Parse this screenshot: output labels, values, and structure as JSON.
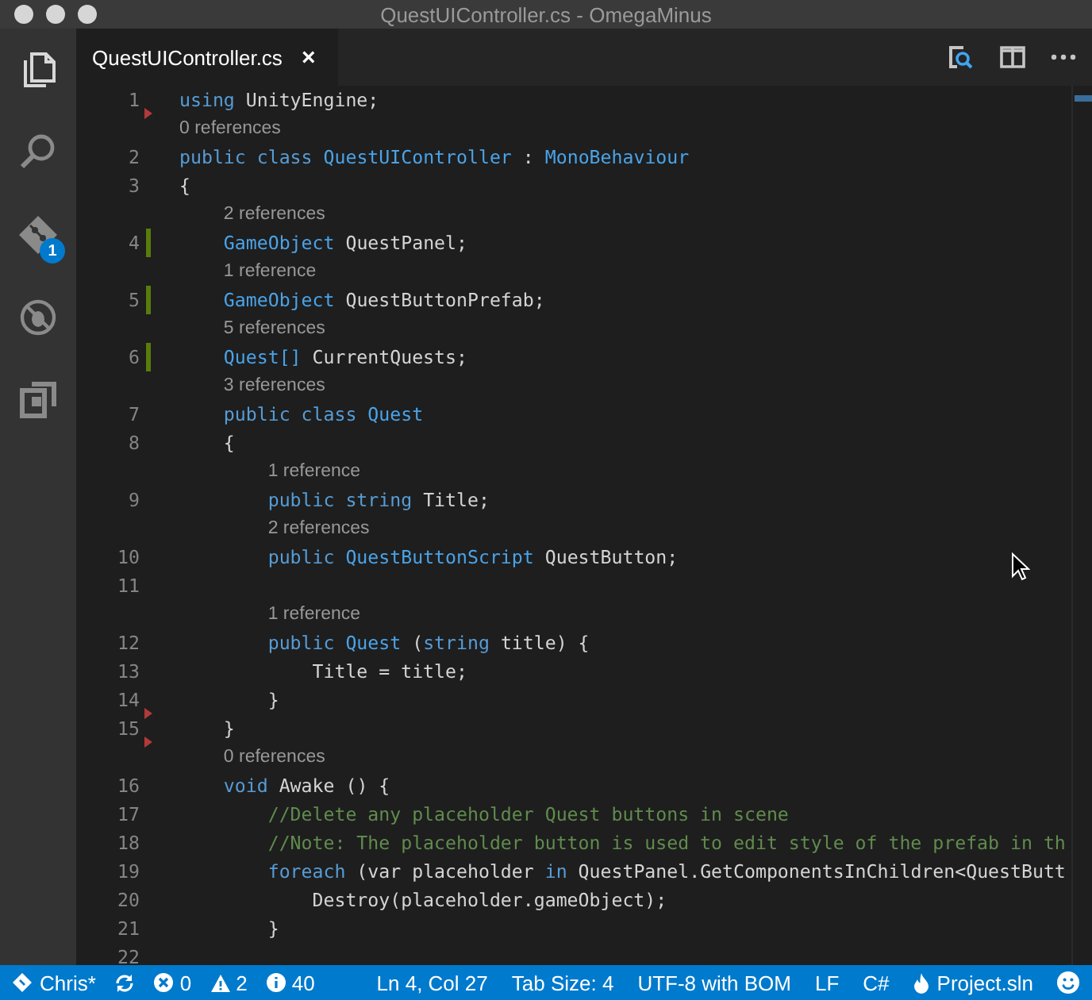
{
  "window": {
    "title": "QuestUIController.cs - OmegaMinus"
  },
  "activity_bar": [
    {
      "kind": "files",
      "selected": true
    },
    {
      "kind": "search",
      "selected": false
    },
    {
      "kind": "git",
      "selected": false,
      "badge": "1"
    },
    {
      "kind": "debug",
      "selected": false
    },
    {
      "kind": "extensions",
      "selected": false
    }
  ],
  "tabs": [
    {
      "label": "QuestUIController.cs",
      "close": "×",
      "selected": true
    }
  ],
  "editor_actions": [
    {
      "kind": "preview"
    },
    {
      "kind": "split"
    },
    {
      "kind": "more"
    }
  ],
  "lines": [
    {
      "number": "1",
      "added": false,
      "deleted": true,
      "tokens": [
        {
          "kind": "keyword",
          "text": "using"
        },
        {
          "kind": "plain",
          "text": " UnityEngine;"
        }
      ]
    },
    {
      "number": "2",
      "added": false,
      "deleted": false,
      "lens": "0 references",
      "tokens": [
        {
          "kind": "keyword",
          "text": "public class "
        },
        {
          "kind": "type",
          "text": "QuestUIController"
        },
        {
          "kind": "plain",
          "text": " : "
        },
        {
          "kind": "type",
          "text": "MonoBehaviour"
        }
      ]
    },
    {
      "number": "3",
      "added": false,
      "deleted": false,
      "tokens": [
        {
          "kind": "plain",
          "text": "{"
        }
      ]
    },
    {
      "number": "4",
      "added": true,
      "deleted": false,
      "lens": "2 references",
      "tokens": [
        {
          "kind": "type",
          "text": "    GameObject"
        },
        {
          "kind": "plain",
          "text": " QuestPanel;"
        }
      ]
    },
    {
      "number": "5",
      "added": true,
      "deleted": false,
      "lens": "1 reference",
      "tokens": [
        {
          "kind": "type",
          "text": "    GameObject"
        },
        {
          "kind": "plain",
          "text": " QuestButtonPrefab;"
        }
      ]
    },
    {
      "number": "6",
      "added": true,
      "deleted": false,
      "lens": "5 references",
      "tokens": [
        {
          "kind": "type",
          "text": "    Quest[]"
        },
        {
          "kind": "plain",
          "text": " CurrentQuests;"
        }
      ]
    },
    {
      "number": "7",
      "added": false,
      "deleted": false,
      "lens": "3 references",
      "tokens": [
        {
          "kind": "keyword",
          "text": "    public class "
        },
        {
          "kind": "type",
          "text": "Quest"
        }
      ]
    },
    {
      "number": "8",
      "added": false,
      "deleted": false,
      "tokens": [
        {
          "kind": "plain",
          "text": "    {"
        }
      ]
    },
    {
      "number": "9",
      "added": false,
      "deleted": false,
      "lens": "1 reference",
      "tokens": [
        {
          "kind": "keyword",
          "text": "        public string "
        },
        {
          "kind": "plain",
          "text": "Title;"
        }
      ]
    },
    {
      "number": "10",
      "added": false,
      "deleted": false,
      "lens": "2 references",
      "tokens": [
        {
          "kind": "keyword",
          "text": "        public "
        },
        {
          "kind": "type",
          "text": "QuestButtonScript"
        },
        {
          "kind": "plain",
          "text": " QuestButton;"
        }
      ]
    },
    {
      "number": "11",
      "added": false,
      "deleted": false
    },
    {
      "number": "12",
      "added": false,
      "deleted": false,
      "lens": "1 reference",
      "tokens": [
        {
          "kind": "keyword",
          "text": "        public "
        },
        {
          "kind": "type",
          "text": "Quest"
        },
        {
          "kind": "plain",
          "text": " ("
        },
        {
          "kind": "keyword",
          "text": "string"
        },
        {
          "kind": "plain",
          "text": " title) {"
        }
      ]
    },
    {
      "number": "13",
      "added": false,
      "deleted": false,
      "tokens": [
        {
          "kind": "plain",
          "text": "            Title = title;"
        }
      ]
    },
    {
      "number": "14",
      "added": false,
      "deleted": true,
      "tokens": [
        {
          "kind": "plain",
          "text": "        }"
        }
      ]
    },
    {
      "number": "15",
      "added": false,
      "deleted": true,
      "tokens": [
        {
          "kind": "plain",
          "text": "    }"
        }
      ]
    },
    {
      "number": "16",
      "added": false,
      "deleted": false,
      "lens": "0 references",
      "tokens": [
        {
          "kind": "keyword",
          "text": "    void "
        },
        {
          "kind": "plain",
          "text": "Awake () {"
        }
      ]
    },
    {
      "number": "17",
      "added": false,
      "deleted": false,
      "tokens": [
        {
          "kind": "comment",
          "text": "        //Delete any placeholder Quest buttons in scene"
        }
      ]
    },
    {
      "number": "18",
      "added": false,
      "deleted": false,
      "tokens": [
        {
          "kind": "comment",
          "text": "        //Note: The placeholder button is used to edit style of the prefab in th"
        }
      ]
    },
    {
      "number": "19",
      "added": false,
      "deleted": false,
      "tokens": [
        {
          "kind": "keyword",
          "text": "        foreach"
        },
        {
          "kind": "plain",
          "text": " (var placeholder "
        },
        {
          "kind": "keyword",
          "text": "in"
        },
        {
          "kind": "plain",
          "text": " QuestPanel.GetComponentsInChildren<QuestButt"
        }
      ]
    },
    {
      "number": "20",
      "added": false,
      "deleted": false,
      "tokens": [
        {
          "kind": "plain",
          "text": "            Destroy(placeholder.gameObject);"
        }
      ]
    },
    {
      "number": "21",
      "added": false,
      "deleted": false,
      "tokens": [
        {
          "kind": "plain",
          "text": "        }"
        }
      ]
    },
    {
      "number": "22",
      "added": false,
      "deleted": false
    }
  ],
  "status_bar": {
    "left": [
      {
        "kind": "branch",
        "text": "Chris*"
      },
      {
        "kind": "sync"
      },
      {
        "kind": "errors",
        "text": "0"
      },
      {
        "kind": "warnings",
        "text": "2"
      },
      {
        "kind": "info",
        "text": "40"
      }
    ],
    "right": [
      {
        "kind": "text",
        "text": "Ln 4, Col 27"
      },
      {
        "kind": "text",
        "text": "Tab Size: 4"
      },
      {
        "kind": "text",
        "text": "UTF-8 with BOM"
      },
      {
        "kind": "text",
        "text": "LF"
      },
      {
        "kind": "text",
        "text": "C#"
      },
      {
        "kind": "project",
        "text": "Project.sln"
      },
      {
        "kind": "feedback"
      }
    ]
  }
}
